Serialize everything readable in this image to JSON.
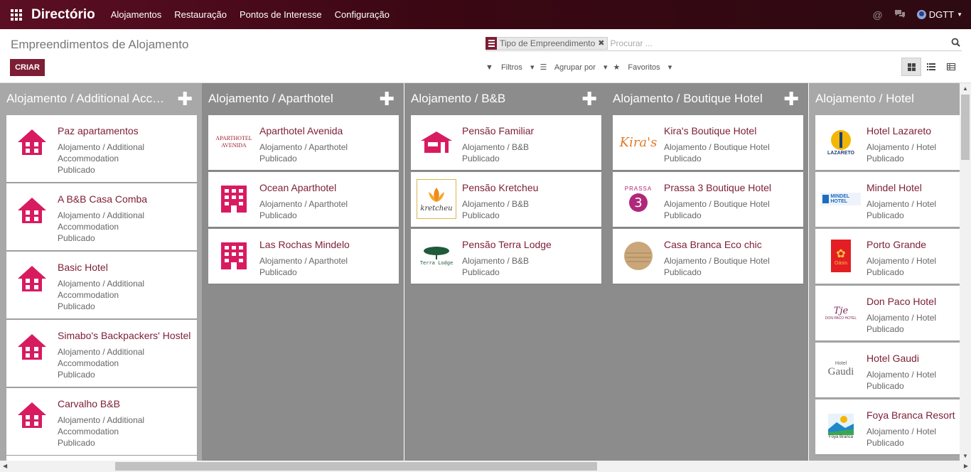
{
  "navbar": {
    "brand": "Directório",
    "menu": [
      "Alojamentos",
      "Restauração",
      "Pontos de Interesse",
      "Configuração"
    ],
    "user": "DGTT"
  },
  "control_panel": {
    "breadcrumb": "Empreendimentos de Alojamento",
    "create_label": "CRIAR",
    "facet_label": "Tipo de Empreendimento",
    "search_placeholder": "Procurar ...",
    "filters_label": "Filtros",
    "groupby_label": "Agrupar por",
    "favorites_label": "Favoritos"
  },
  "kanban": {
    "columns": [
      {
        "title": "Alojamento / Additional Acco...",
        "show_add": true,
        "cards": [
          {
            "name": "Paz apartamentos",
            "type": "Alojamento / Additional Accommodation",
            "status": "Publicado"
          },
          {
            "name": "A B&B Casa Comba",
            "type": "Alojamento / Additional Accommodation",
            "status": "Publicado"
          },
          {
            "name": "Basic Hotel",
            "type": "Alojamento / Additional Accommodation",
            "status": "Publicado"
          },
          {
            "name": "Simabo's Backpackers' Hostel",
            "type": "Alojamento / Additional Accommodation",
            "status": "Publicado"
          },
          {
            "name": "Carvalho B&B",
            "type": "Alojamento / Additional Accommodation",
            "status": "Publicado"
          }
        ]
      },
      {
        "title": "Alojamento / Aparthotel",
        "show_add": true,
        "cards": [
          {
            "name": "Aparthotel Avenida",
            "type": "Alojamento / Aparthotel",
            "status": "Publicado",
            "logo_text": "APARTHOTEL AVENIDA"
          },
          {
            "name": "Ocean Aparthotel",
            "type": "Alojamento / Aparthotel",
            "status": "Publicado"
          },
          {
            "name": "Las Rochas Mindelo",
            "type": "Alojamento / Aparthotel",
            "status": "Publicado"
          }
        ]
      },
      {
        "title": "Alojamento / B&B",
        "show_add": true,
        "cards": [
          {
            "name": "Pensão Familiar",
            "type": "Alojamento / B&B",
            "status": "Publicado"
          },
          {
            "name": "Pensão Kretcheu",
            "type": "Alojamento / B&B",
            "status": "Publicado",
            "logo_text": "kretcheu"
          },
          {
            "name": "Pensão Terra Lodge",
            "type": "Alojamento / B&B",
            "status": "Publicado",
            "logo_text": "Terra Lodge"
          }
        ]
      },
      {
        "title": "Alojamento / Boutique Hotel",
        "show_add": true,
        "cards": [
          {
            "name": "Kira's Boutique Hotel",
            "type": "Alojamento / Boutique Hotel",
            "status": "Publicado",
            "logo_text": "Kira's"
          },
          {
            "name": "Prassa 3 Boutique Hotel",
            "type": "Alojamento / Boutique Hotel",
            "status": "Publicado",
            "logo_text": "PRASSA"
          },
          {
            "name": "Casa Branca Eco chic",
            "type": "Alojamento / Boutique Hotel",
            "status": "Publicado"
          }
        ]
      },
      {
        "title": "Alojamento / Hotel",
        "show_add": false,
        "cards": [
          {
            "name": "Hotel Lazareto",
            "type": "Alojamento / Hotel",
            "status": "Publicado",
            "logo_text": "LAZARETO"
          },
          {
            "name": "Mindel Hotel",
            "type": "Alojamento / Hotel",
            "status": "Publicado",
            "logo_text": "MINDEL HOTEL"
          },
          {
            "name": "Porto Grande",
            "type": "Alojamento / Hotel",
            "status": "Publicado",
            "logo_text": "Oásis"
          },
          {
            "name": "Don Paco Hotel",
            "type": "Alojamento / Hotel",
            "status": "Publicado",
            "logo_text": "DON PACO HOTEL"
          },
          {
            "name": "Hotel Gaudi",
            "type": "Alojamento / Hotel",
            "status": "Publicado",
            "logo_text": "Gaudi"
          },
          {
            "name": "Foya Branca Resort",
            "type": "Alojamento / Hotel",
            "status": "Publicado",
            "logo_text": "Foya Branca"
          }
        ]
      }
    ]
  },
  "colors": {
    "primary": "#7c1e35",
    "column_bg_light": "#a8a8a8",
    "column_bg_dark": "#8c8c8c",
    "house_icon": "#d81b60"
  }
}
